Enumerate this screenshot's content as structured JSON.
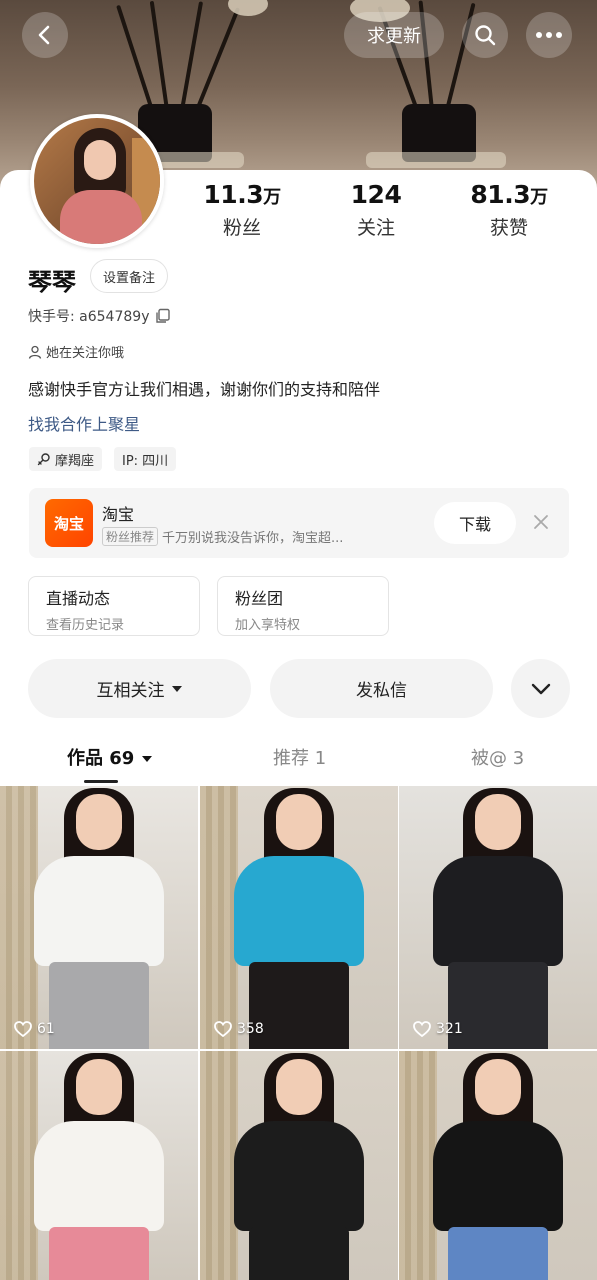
{
  "header": {
    "update_label": "求更新"
  },
  "profile": {
    "name": "琴琴",
    "remark_button": "设置备注",
    "kuaishou_id": "快手号: a654789y",
    "follow_note": "她在关注你哦",
    "bio": "感谢快手官方让我们相遇，谢谢你们的支持和陪伴",
    "coop_link": "找我合作上聚星",
    "tags": [
      {
        "label": "摩羯座",
        "icon": "zodiac-icon"
      },
      {
        "label": "IP: 四川",
        "icon": ""
      }
    ]
  },
  "stats": [
    {
      "num": "11.3",
      "unit": "万",
      "label": "粉丝"
    },
    {
      "num": "124",
      "unit": "",
      "label": "关注"
    },
    {
      "num": "81.3",
      "unit": "万",
      "label": "获赞"
    }
  ],
  "ad": {
    "logo_text": "淘宝",
    "title": "淘宝",
    "chip": "粉丝推荐",
    "desc": "千万别说我没告诉你，淘宝超...",
    "download_label": "下载",
    "brand_color": "#ff5000"
  },
  "features": [
    {
      "title": "直播动态",
      "sub": "查看历史记录"
    },
    {
      "title": "粉丝团",
      "sub": "加入享特权"
    }
  ],
  "actions": {
    "mutual_follow": "互相关注",
    "message": "发私信"
  },
  "tabs": [
    {
      "label": "作品 69",
      "active": true
    },
    {
      "label": "推荐 1",
      "active": false
    },
    {
      "label": "被@ 3",
      "active": false
    }
  ],
  "videos": [
    {
      "likes": "61",
      "top_color": "#f4f4f2",
      "bottom_color": "#a9a9ab"
    },
    {
      "likes": "358",
      "top_color": "#27a8d0",
      "bottom_color": "#1e1a1a"
    },
    {
      "likes": "321",
      "top_color": "#1d1d20",
      "bottom_color": "#2a2a2e"
    },
    {
      "likes": "",
      "top_color": "#f5f3ef",
      "bottom_color": "#e78a98"
    },
    {
      "likes": "",
      "top_color": "#1c1c1c",
      "bottom_color": "#1c1c1c"
    },
    {
      "likes": "",
      "top_color": "#151515",
      "bottom_color": "#5e86c4"
    }
  ]
}
